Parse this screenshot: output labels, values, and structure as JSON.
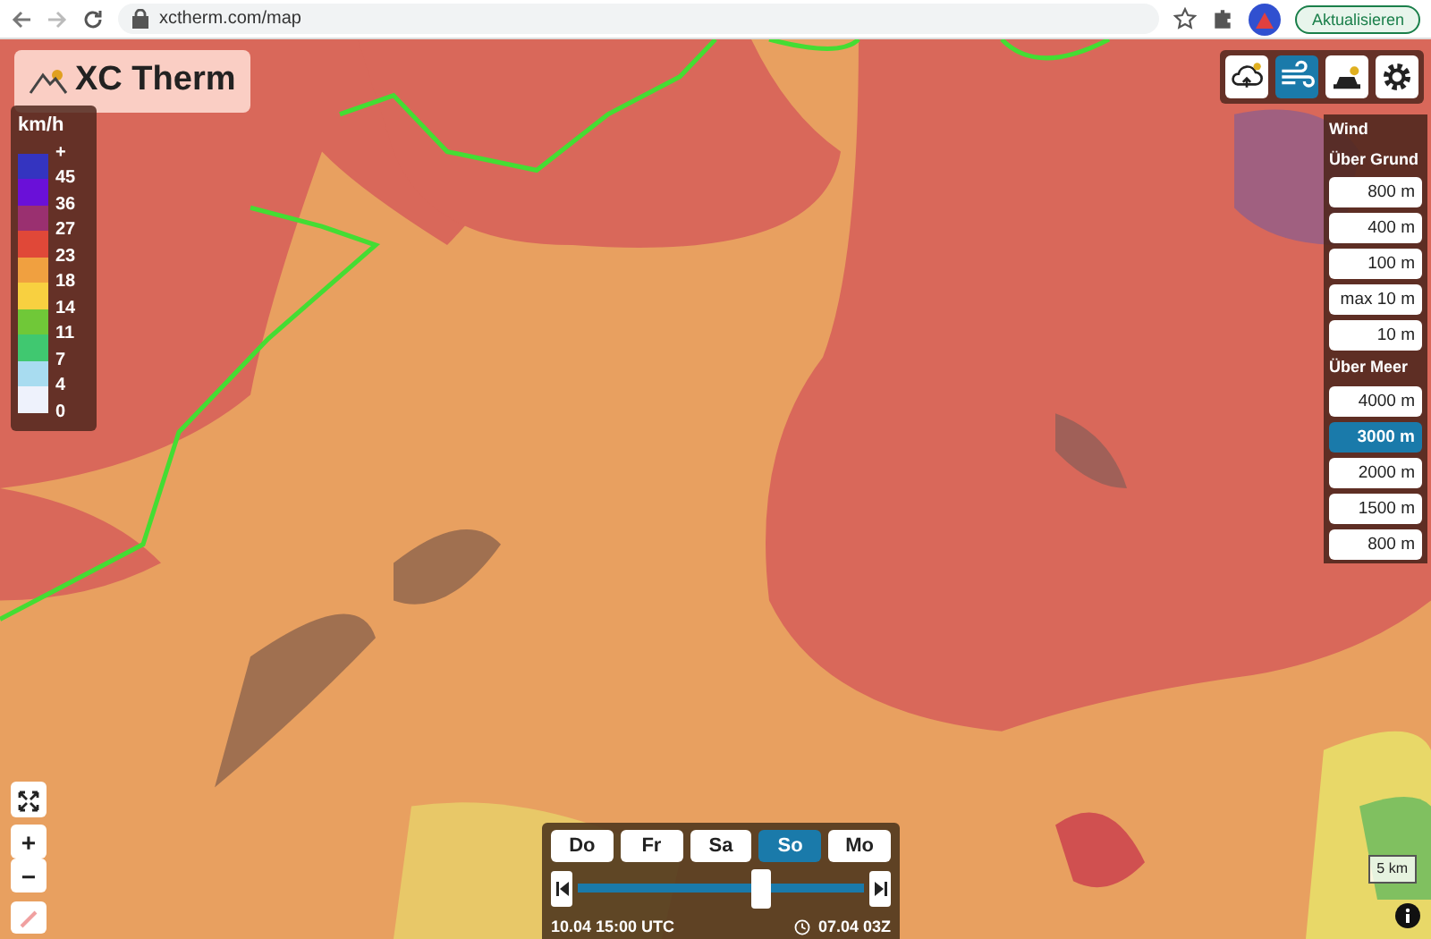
{
  "browser": {
    "url": "xctherm.com/map",
    "update_button": "Aktualisieren"
  },
  "logo": "XC Therm",
  "layer_buttons": [
    {
      "kind": "cloud",
      "selected": false
    },
    {
      "kind": "wind",
      "selected": true
    },
    {
      "kind": "weather",
      "selected": false
    },
    {
      "kind": "settings",
      "selected": false
    }
  ],
  "legend": {
    "unit": "km/h",
    "labels": [
      "+",
      "45",
      "36",
      "27",
      "23",
      "18",
      "14",
      "11",
      "7",
      "4",
      "0"
    ],
    "swatches": [
      {
        "color": "#3434c0"
      },
      {
        "color": "#6a10d8"
      },
      {
        "color": "#9a3070"
      },
      {
        "color": "#e04838"
      },
      {
        "color": "#f0a040"
      },
      {
        "color": "#f8d040"
      },
      {
        "color": "#70c838"
      },
      {
        "color": "#40c870"
      },
      {
        "color": "#a8dcf0"
      },
      {
        "color": "#eef2fc"
      }
    ]
  },
  "height_panel": {
    "title": "Wind",
    "groups": [
      {
        "title": "Über Grund",
        "options": [
          {
            "label": "800 m",
            "selected": false
          },
          {
            "label": "400 m",
            "selected": false
          },
          {
            "label": "100 m",
            "selected": false
          },
          {
            "label": "max 10 m",
            "selected": false
          },
          {
            "label": "10 m",
            "selected": false
          }
        ]
      },
      {
        "title": "Über Meer",
        "options": [
          {
            "label": "4000 m",
            "selected": false
          },
          {
            "label": "3000 m",
            "selected": true
          },
          {
            "label": "2000 m",
            "selected": false
          },
          {
            "label": "1500 m",
            "selected": false
          },
          {
            "label": "800 m",
            "selected": false
          }
        ]
      }
    ]
  },
  "days": [
    {
      "label": "Do",
      "selected": false
    },
    {
      "label": "Fr",
      "selected": false
    },
    {
      "label": "Sa",
      "selected": false
    },
    {
      "label": "So",
      "selected": true
    },
    {
      "label": "Mo",
      "selected": false
    }
  ],
  "timeline": {
    "level": 0.64,
    "time": "10.04 15:00 UTC",
    "model_run": "07.04 03Z"
  },
  "map_controls": {
    "zoom_in": "+",
    "zoom_out": "−"
  },
  "scale": "5 km"
}
